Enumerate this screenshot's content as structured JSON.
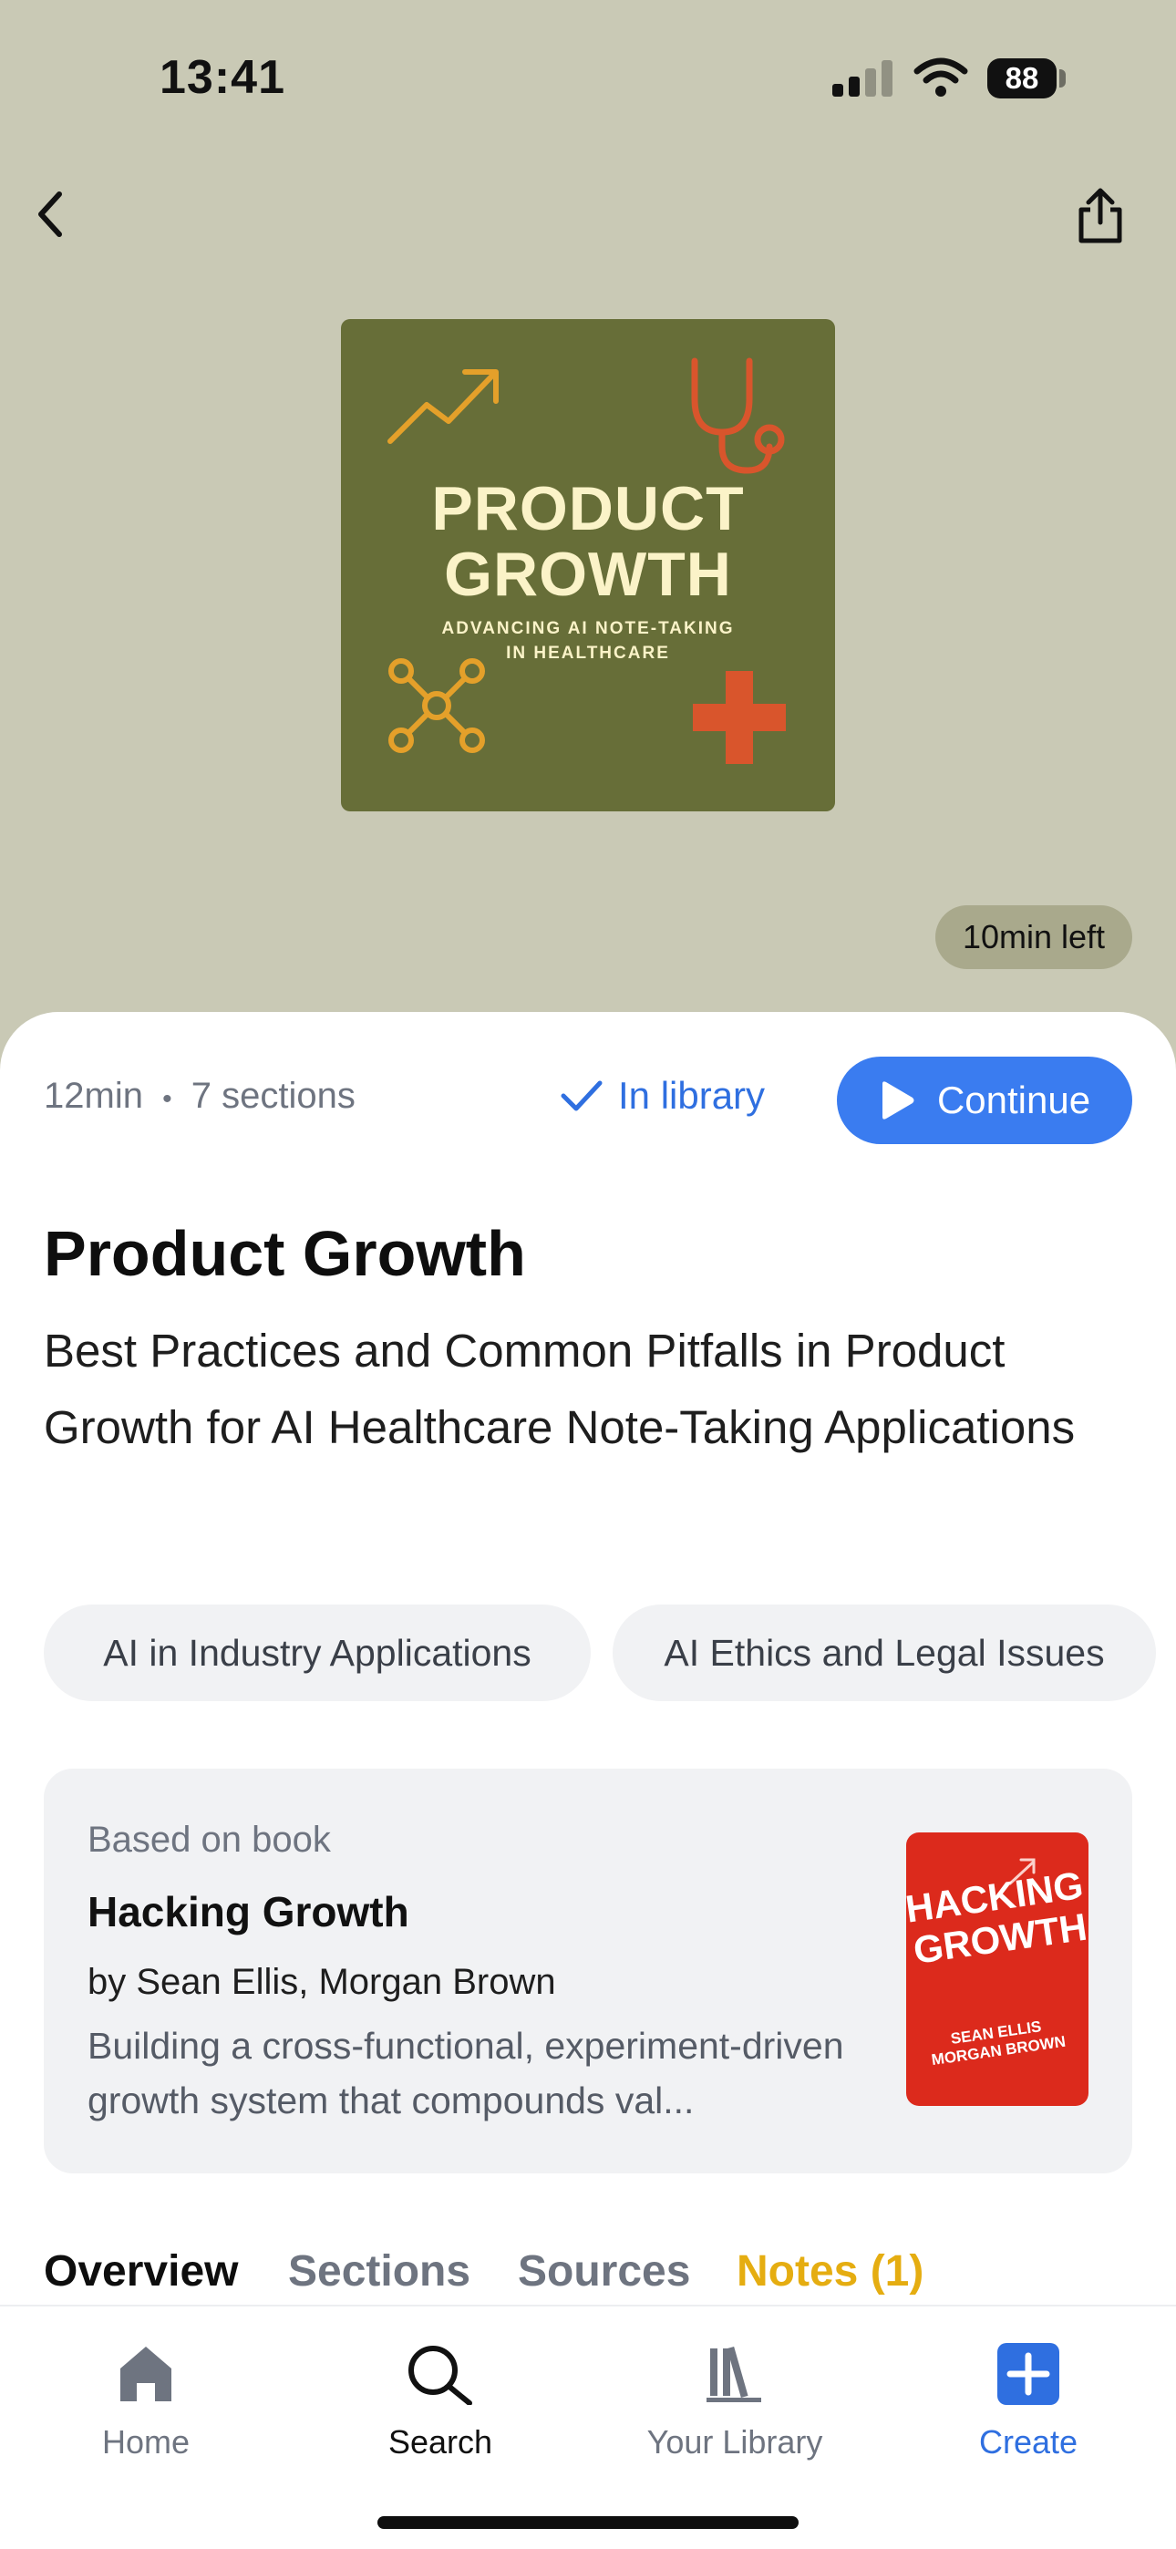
{
  "status_bar": {
    "time": "13:41",
    "battery": "88"
  },
  "header": {
    "back_icon": "chevron-left-icon",
    "share_icon": "share-icon"
  },
  "cover": {
    "title_line1": "PRODUCT",
    "title_line2": "GROWTH",
    "subtitle_line1": "ADVANCING AI NOTE-TAKING",
    "subtitle_line2": "IN HEALTHCARE",
    "bg_color": "#676e38"
  },
  "time_left": "10min left",
  "meta": {
    "duration": "12min",
    "separator": "•",
    "sections": "7 sections"
  },
  "actions": {
    "in_library": "In library",
    "continue": "Continue",
    "accent": "#3a7cf0"
  },
  "title": "Product Growth",
  "subtitle": "Best Practices and Common Pitfalls in Product Growth for AI Healthcare Note-Taking Applications",
  "tags": [
    "AI in Industry Applications",
    "AI Ethics and Legal Issues"
  ],
  "book": {
    "label": "Based on book",
    "title": "Hacking Growth",
    "authors": "by Sean Ellis, Morgan Brown",
    "description": "Building a cross-functional, experiment-driven growth system that compounds val...",
    "cover_title_line1": "HACKING",
    "cover_title_line2": "GROWTH",
    "cover_author_line1": "SEAN ELLIS",
    "cover_author_line2": "MORGAN BROWN"
  },
  "tabs": [
    {
      "label": "Overview"
    },
    {
      "label": "Sections"
    },
    {
      "label": "Sources"
    },
    {
      "label": "Notes (1)"
    }
  ],
  "bottom_nav": [
    {
      "label": "Home",
      "icon": "home-icon"
    },
    {
      "label": "Search",
      "icon": "search-icon"
    },
    {
      "label": "Your Library",
      "icon": "library-icon"
    },
    {
      "label": "Create",
      "icon": "plus-icon"
    }
  ]
}
